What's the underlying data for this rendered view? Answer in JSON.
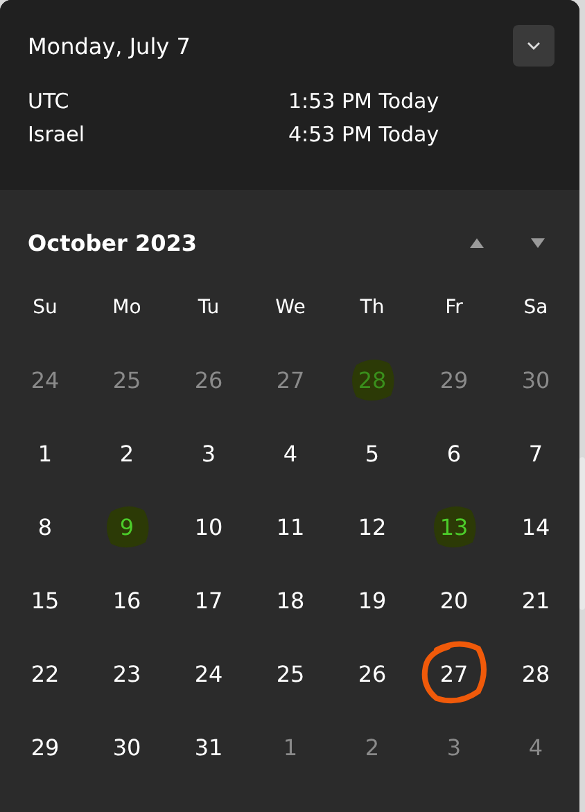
{
  "header": {
    "date": "Monday, July 7"
  },
  "clocks": [
    {
      "zone": "UTC",
      "time": "1:53 PM Today"
    },
    {
      "zone": "Israel",
      "time": "4:53 PM Today"
    }
  ],
  "calendar": {
    "month": "October 2023",
    "weekdays": [
      "Su",
      "Mo",
      "Tu",
      "We",
      "Th",
      "Fr",
      "Sa"
    ],
    "days": [
      {
        "label": "24",
        "outside": true,
        "highlighted": false,
        "circled": false
      },
      {
        "label": "25",
        "outside": true,
        "highlighted": false,
        "circled": false
      },
      {
        "label": "26",
        "outside": true,
        "highlighted": false,
        "circled": false
      },
      {
        "label": "27",
        "outside": true,
        "highlighted": false,
        "circled": false
      },
      {
        "label": "28",
        "outside": true,
        "highlighted": true,
        "circled": false
      },
      {
        "label": "29",
        "outside": true,
        "highlighted": false,
        "circled": false
      },
      {
        "label": "30",
        "outside": true,
        "highlighted": false,
        "circled": false
      },
      {
        "label": "1",
        "outside": false,
        "highlighted": false,
        "circled": false
      },
      {
        "label": "2",
        "outside": false,
        "highlighted": false,
        "circled": false
      },
      {
        "label": "3",
        "outside": false,
        "highlighted": false,
        "circled": false
      },
      {
        "label": "4",
        "outside": false,
        "highlighted": false,
        "circled": false
      },
      {
        "label": "5",
        "outside": false,
        "highlighted": false,
        "circled": false
      },
      {
        "label": "6",
        "outside": false,
        "highlighted": false,
        "circled": false
      },
      {
        "label": "7",
        "outside": false,
        "highlighted": false,
        "circled": false
      },
      {
        "label": "8",
        "outside": false,
        "highlighted": false,
        "circled": false
      },
      {
        "label": "9",
        "outside": false,
        "highlighted": true,
        "circled": false
      },
      {
        "label": "10",
        "outside": false,
        "highlighted": false,
        "circled": false
      },
      {
        "label": "11",
        "outside": false,
        "highlighted": false,
        "circled": false
      },
      {
        "label": "12",
        "outside": false,
        "highlighted": false,
        "circled": false
      },
      {
        "label": "13",
        "outside": false,
        "highlighted": true,
        "circled": false
      },
      {
        "label": "14",
        "outside": false,
        "highlighted": false,
        "circled": false
      },
      {
        "label": "15",
        "outside": false,
        "highlighted": false,
        "circled": false
      },
      {
        "label": "16",
        "outside": false,
        "highlighted": false,
        "circled": false
      },
      {
        "label": "17",
        "outside": false,
        "highlighted": false,
        "circled": false
      },
      {
        "label": "18",
        "outside": false,
        "highlighted": false,
        "circled": false
      },
      {
        "label": "19",
        "outside": false,
        "highlighted": false,
        "circled": false
      },
      {
        "label": "20",
        "outside": false,
        "highlighted": false,
        "circled": false
      },
      {
        "label": "21",
        "outside": false,
        "highlighted": false,
        "circled": false
      },
      {
        "label": "22",
        "outside": false,
        "highlighted": false,
        "circled": false
      },
      {
        "label": "23",
        "outside": false,
        "highlighted": false,
        "circled": false
      },
      {
        "label": "24",
        "outside": false,
        "highlighted": false,
        "circled": false
      },
      {
        "label": "25",
        "outside": false,
        "highlighted": false,
        "circled": false
      },
      {
        "label": "26",
        "outside": false,
        "highlighted": false,
        "circled": false
      },
      {
        "label": "27",
        "outside": false,
        "highlighted": false,
        "circled": true
      },
      {
        "label": "28",
        "outside": false,
        "highlighted": false,
        "circled": false
      },
      {
        "label": "29",
        "outside": false,
        "highlighted": false,
        "circled": false
      },
      {
        "label": "30",
        "outside": false,
        "highlighted": false,
        "circled": false
      },
      {
        "label": "31",
        "outside": false,
        "highlighted": false,
        "circled": false
      },
      {
        "label": "1",
        "outside": true,
        "highlighted": false,
        "circled": false
      },
      {
        "label": "2",
        "outside": true,
        "highlighted": false,
        "circled": false
      },
      {
        "label": "3",
        "outside": true,
        "highlighted": false,
        "circled": false
      },
      {
        "label": "4",
        "outside": true,
        "highlighted": false,
        "circled": false
      }
    ]
  }
}
